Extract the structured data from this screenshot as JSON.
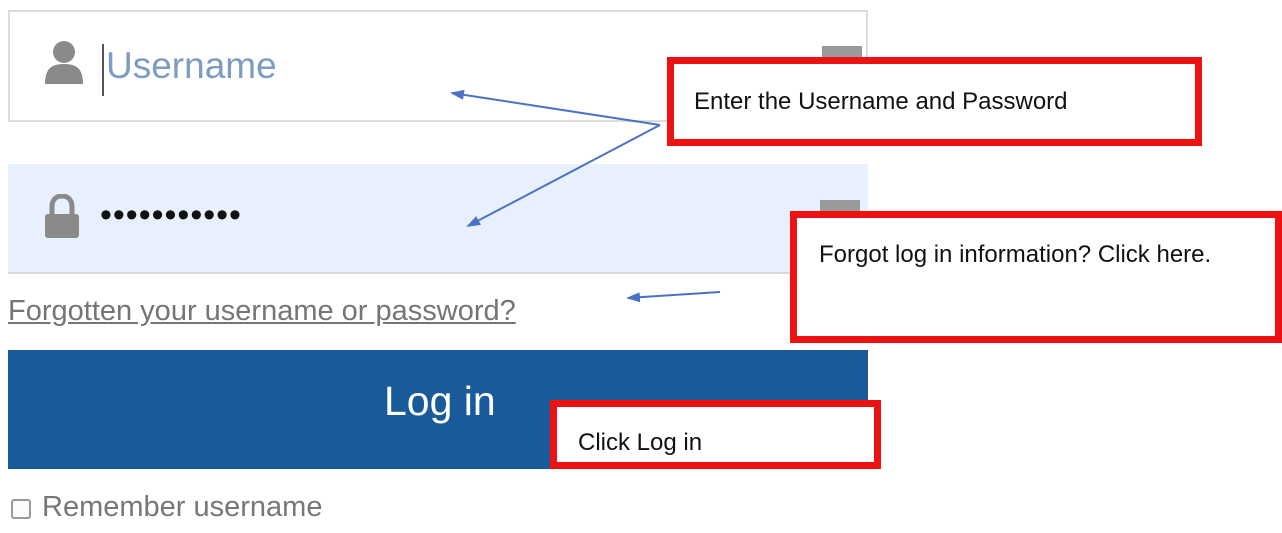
{
  "login_form": {
    "username": {
      "value": "",
      "placeholder": "Username",
      "icon": "user-icon"
    },
    "password": {
      "value": "•••••••••••",
      "icon": "lock-icon"
    },
    "forgot_link": "Forgotten your username or password?",
    "login_button": "Log in",
    "remember": {
      "label": "Remember username",
      "checked": false
    }
  },
  "annotations": {
    "credentials": "Enter the Username and Password",
    "forgot": "Forgot log in information? Click here.",
    "login": "Click Log in"
  },
  "colors": {
    "button": "#185a9a",
    "callout_border": "#ee1111",
    "arrow": "#4a72c4",
    "password_field_bg": "#e8f0fe"
  }
}
